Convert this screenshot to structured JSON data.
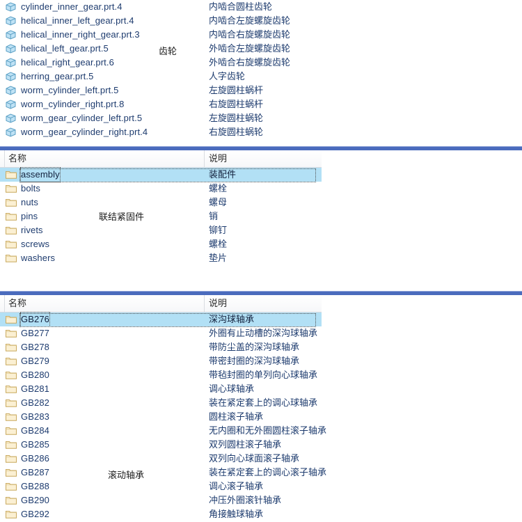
{
  "panels": [
    {
      "id": "gears",
      "group_label": "齿轮",
      "columns": {
        "name": "名称",
        "desc": "说明"
      },
      "show_header": false,
      "rows": [
        {
          "name": "cylinder_inner_gear.prt.4",
          "desc": "内啮合圆柱齿轮",
          "icon": "part-cube-icon",
          "selected": false
        },
        {
          "name": "helical_inner_left_gear.prt.4",
          "desc": "内啮合左旋螺旋齿轮",
          "icon": "part-cube-icon",
          "selected": false
        },
        {
          "name": "helical_inner_right_gear.prt.3",
          "desc": "内啮合右旋螺旋齿轮",
          "icon": "part-cube-icon",
          "selected": false
        },
        {
          "name": "helical_left_gear.prt.5",
          "desc": "外啮合左旋螺旋齿轮",
          "icon": "part-cube-icon",
          "selected": false
        },
        {
          "name": "helical_right_gear.prt.6",
          "desc": "外啮合右旋螺旋齿轮",
          "icon": "part-cube-icon",
          "selected": false
        },
        {
          "name": "herring_gear.prt.5",
          "desc": "人字齿轮",
          "icon": "part-cube-icon",
          "selected": false
        },
        {
          "name": "worm_cylinder_left.prt.5",
          "desc": "左旋圆柱蜗杆",
          "icon": "part-cube-icon",
          "selected": false
        },
        {
          "name": "worm_cylinder_right.prt.8",
          "desc": "右旋圆柱蜗杆",
          "icon": "part-cube-icon",
          "selected": false
        },
        {
          "name": "worm_gear_cylinder_left.prt.5",
          "desc": "左旋圆柱蜗轮",
          "icon": "part-cube-icon",
          "selected": false
        },
        {
          "name": "worm_gear_cylinder_right.prt.4",
          "desc": "右旋圆柱蜗轮",
          "icon": "part-cube-icon",
          "selected": false
        }
      ],
      "thumbnails": [
        {
          "shape": "bevel-gear-icon",
          "row": 0,
          "col": 0
        },
        {
          "shape": "spur-gear-small-icon",
          "row": 0,
          "col": 1
        },
        {
          "shape": "ring-gear-top-icon",
          "row": 0,
          "col": 2
        },
        {
          "shape": "internal-ring-gear-icon",
          "row": 1,
          "col": 0
        },
        {
          "shape": "helical-gear-icon",
          "row": 1,
          "col": 1
        },
        {
          "shape": "herringbone-gear-icon",
          "row": 1,
          "col": 2
        },
        {
          "shape": "worm-left-icon",
          "row": 2,
          "col": 0
        },
        {
          "shape": "worm-right-icon",
          "row": 2,
          "col": 1
        },
        {
          "shape": "worm-wheel-icon",
          "row": 2,
          "col": 2
        }
      ]
    },
    {
      "id": "fasteners",
      "group_label": "联结紧固件",
      "columns": {
        "name": "名称",
        "desc": "说明"
      },
      "show_header": true,
      "rows": [
        {
          "name": "assembly",
          "desc": "装配件",
          "icon": "folder-icon",
          "selected": true
        },
        {
          "name": "bolts",
          "desc": "螺栓",
          "icon": "folder-icon",
          "selected": false
        },
        {
          "name": "nuts",
          "desc": "螺母",
          "icon": "folder-icon",
          "selected": false
        },
        {
          "name": "pins",
          "desc": "销",
          "icon": "folder-icon",
          "selected": false
        },
        {
          "name": "rivets",
          "desc": "铆钉",
          "icon": "folder-icon",
          "selected": false
        },
        {
          "name": "screws",
          "desc": "螺栓",
          "icon": "folder-icon",
          "selected": false
        },
        {
          "name": "washers",
          "desc": "垫片",
          "icon": "folder-icon",
          "selected": false
        }
      ],
      "thumbnails": [
        {
          "shape": "cross-bolt-icon",
          "row": 0,
          "col": 0
        },
        {
          "shape": "hex-bolt-icon",
          "row": 0,
          "col": 1
        },
        {
          "shape": "hex-nut-icon",
          "row": 0,
          "col": 2
        },
        {
          "shape": "pin-icon",
          "row": 0,
          "col": 3
        },
        {
          "shape": "rivet-icon",
          "row": 0,
          "col": 4
        },
        {
          "shape": "spring-washer-icon",
          "row": 1,
          "col": 0
        },
        {
          "shape": "tab-washer-icon",
          "row": 1,
          "col": 1
        },
        {
          "shape": "lock-washer-icon",
          "row": 1,
          "col": 2
        }
      ]
    },
    {
      "id": "bearings",
      "group_label": "滚动轴承",
      "columns": {
        "name": "名称",
        "desc": "说明"
      },
      "show_header": true,
      "rows": [
        {
          "name": "GB276",
          "desc": "深沟球轴承",
          "icon": "folder-icon",
          "selected": true
        },
        {
          "name": "GB277",
          "desc": "外圈有止动槽的深沟球轴承",
          "icon": "folder-icon",
          "selected": false
        },
        {
          "name": "GB278",
          "desc": "带防尘盖的深沟球轴承",
          "icon": "folder-icon",
          "selected": false
        },
        {
          "name": "GB279",
          "desc": "带密封圈的深沟球轴承",
          "icon": "folder-icon",
          "selected": false
        },
        {
          "name": "GB280",
          "desc": "带毡封圈的单列向心球轴承",
          "icon": "folder-icon",
          "selected": false
        },
        {
          "name": "GB281",
          "desc": "调心球轴承",
          "icon": "folder-icon",
          "selected": false
        },
        {
          "name": "GB282",
          "desc": "装在紧定套上的调心球轴承",
          "icon": "folder-icon",
          "selected": false
        },
        {
          "name": "GB283",
          "desc": "圆柱滚子轴承",
          "icon": "folder-icon",
          "selected": false
        },
        {
          "name": "GB284",
          "desc": "无内圈和无外圈圆柱滚子轴承",
          "icon": "folder-icon",
          "selected": false
        },
        {
          "name": "GB285",
          "desc": "双列圆柱滚子轴承",
          "icon": "folder-icon",
          "selected": false
        },
        {
          "name": "GB286",
          "desc": "双列向心球面滚子轴承",
          "icon": "folder-icon",
          "selected": false
        },
        {
          "name": "GB287",
          "desc": "装在紧定套上的调心滚子轴承",
          "icon": "folder-icon",
          "selected": false
        },
        {
          "name": "GB288",
          "desc": "调心滚子轴承",
          "icon": "folder-icon",
          "selected": false
        },
        {
          "name": "GB290",
          "desc": "冲压外圈滚针轴承",
          "icon": "folder-icon",
          "selected": false
        },
        {
          "name": "GB292",
          "desc": "角接触球轴承",
          "icon": "folder-icon",
          "selected": false
        }
      ],
      "thumbnails": [
        {
          "shape": "ball-bearing-icon",
          "row": 0,
          "col": 0
        },
        {
          "shape": "ball-bearing-groove-icon",
          "row": 0,
          "col": 1
        }
      ]
    }
  ],
  "colors": {
    "separator": "#4a6bbd",
    "selection": "#b2e0f5",
    "list_text": "#1d3b6e",
    "thumb_bg": "#eceef1",
    "metal_light": "#c3ccd8",
    "metal_mid": "#9aa7b8",
    "metal_dark": "#6f7d90",
    "folder": "#f7e6bf"
  }
}
